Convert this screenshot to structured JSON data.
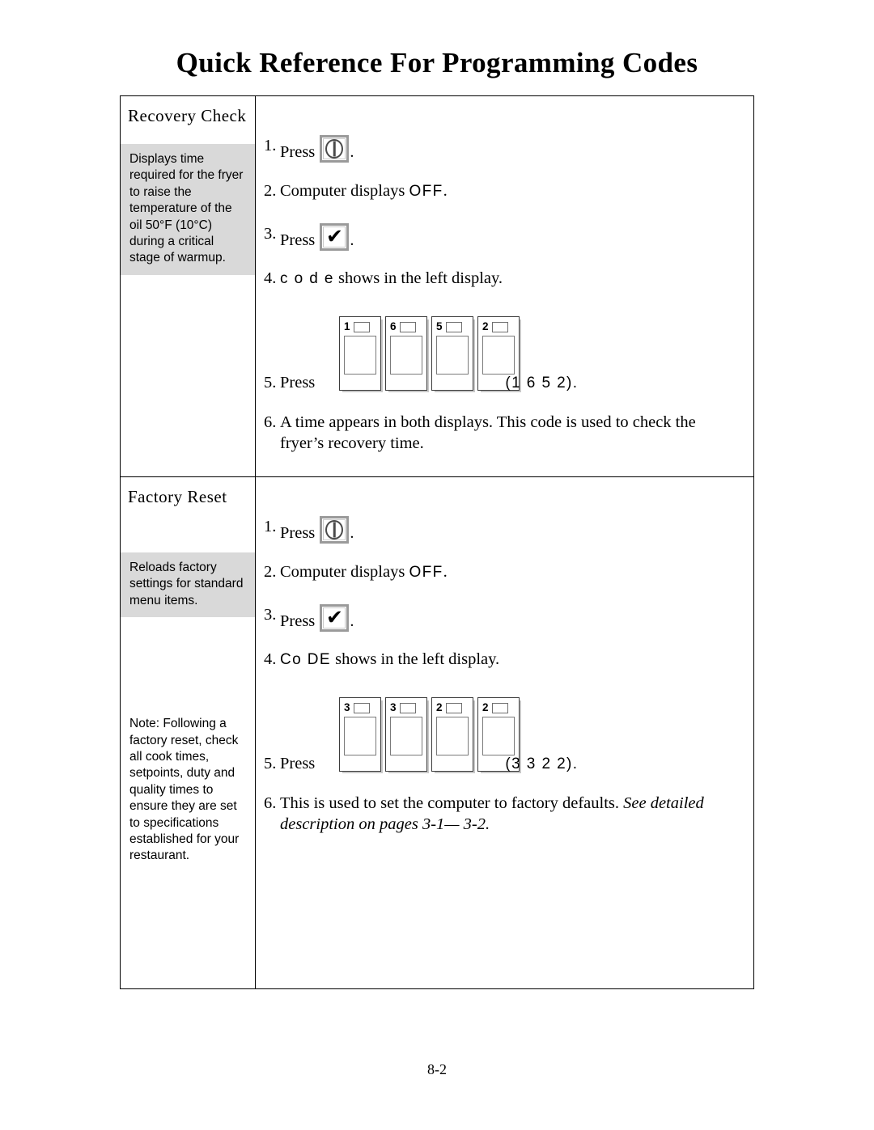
{
  "document": {
    "title": "Quick Reference For Programming Codes",
    "page_number": "8-2"
  },
  "colors": {
    "description_box_background": "#d9d9d9",
    "table_border": "#000000",
    "key_border": "#9a9a9a",
    "page_background": "#ffffff"
  },
  "sections": [
    {
      "name": "Recovery Check",
      "description": "Displays time required for the fryer to raise the temperature of the oil 50°F (10°C) during a critical stage of warmup.",
      "steps": {
        "s1_num": "1.",
        "s1_text": "Press",
        "s1_icon": "power-button-icon",
        "s1_period": ".",
        "s2_num": "2.",
        "s2_text_before": "Computer displays",
        "s2_display_word": "OFF",
        "s2_period": ".",
        "s3_num": "3.",
        "s3_text": "Press",
        "s3_icon": "checkmark-button-icon",
        "s3_period": ".",
        "s4_num": "4.",
        "s4_display_word": "c o d e",
        "s4_text_after": "shows in the left display.",
        "s5_num": "5.",
        "s5_text": "Press",
        "s5_code_label": "(1 6 5 2).",
        "s6_num": "6.",
        "s6_text": "A time appears in both displays. This code is used to check the fryer’s recovery time."
      },
      "keypad": {
        "keys": [
          "1",
          "6",
          "5",
          "2"
        ]
      }
    },
    {
      "name": "Factory Reset",
      "description": "Reloads factory settings for standard menu items.",
      "note": "Note: Following a factory reset, check all cook times, setpoints, duty and quality times to ensure they are set to specifications established for your restaurant.",
      "steps": {
        "s1_num": "1.",
        "s1_text": "Press",
        "s1_icon": "power-button-icon",
        "s1_period": ".",
        "s2_num": "2.",
        "s2_text_before": "Computer displays",
        "s2_display_word": "OFF",
        "s2_period": ".",
        "s3_num": "3.",
        "s3_text": "Press",
        "s3_icon": "checkmark-button-icon",
        "s3_period": ".",
        "s4_num": "4.",
        "s4_display_word": "Co DE",
        "s4_text_after": "shows in the left display.",
        "s5_num": "5.",
        "s5_text": "Press",
        "s5_code_label": "(3 3 2 2).",
        "s6_num": "6.",
        "s6_text_plain": "This is used to set the computer to factory defaults.",
        "s6_text_italic": "See detailed description on pages 3-1— 3-2."
      },
      "keypad": {
        "keys": [
          "3",
          "3",
          "2",
          "2"
        ]
      }
    }
  ]
}
